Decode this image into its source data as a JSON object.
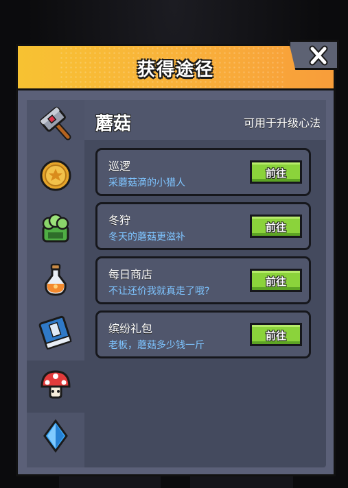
{
  "dialog": {
    "title": "获得途径",
    "close_symbol": "✕"
  },
  "item": {
    "name": "蘑菇",
    "use": "可用于升级心法"
  },
  "sidebar_items": [
    {
      "icon": "hammer-icon"
    },
    {
      "icon": "gold-coin-icon"
    },
    {
      "icon": "green-jar-icon"
    },
    {
      "icon": "potion-bottle-icon"
    },
    {
      "icon": "blue-book-icon"
    },
    {
      "icon": "mushroom-icon",
      "active": true
    },
    {
      "icon": "blue-crystal-icon"
    }
  ],
  "sources": [
    {
      "title": "巡逻",
      "desc": "采蘑菇滴的小猎人",
      "button": "前往"
    },
    {
      "title": "冬狩",
      "desc": "冬天的蘑菇更滋补",
      "button": "前往"
    },
    {
      "title": "每日商店",
      "desc": "不让还价我就真走了哦?",
      "button": "前往"
    },
    {
      "title": "缤纷礼包",
      "desc": "老板，蘑菇多少钱一斤",
      "button": "前往"
    }
  ],
  "colors": {
    "header": "#f7c232",
    "panel": "#5b6078",
    "button": "#8bd33b",
    "desc_text": "#7ec4ff"
  }
}
